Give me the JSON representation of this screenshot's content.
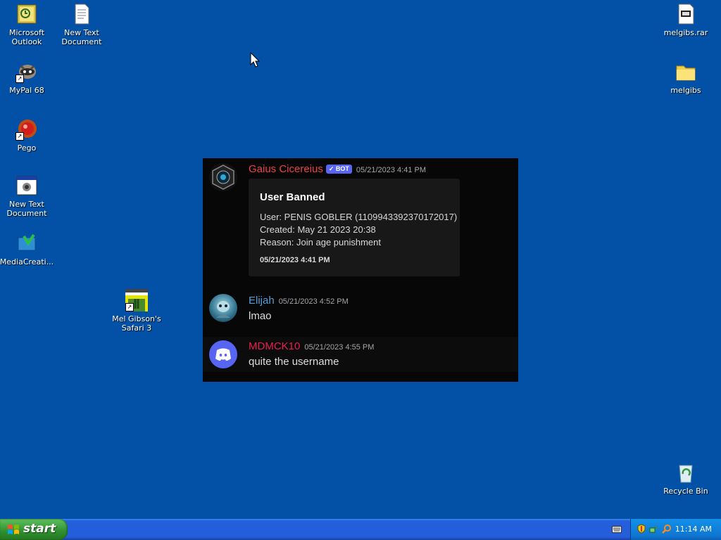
{
  "desktop": {
    "icons": [
      {
        "label": "Microsoft\nOutlook",
        "icon": "outlook-icon"
      },
      {
        "label": "New Text\nDocument",
        "icon": "text-document-icon"
      },
      {
        "label": "MyPal 68",
        "icon": "mypal-browser-icon"
      },
      {
        "label": "Pego",
        "icon": "pego-icon"
      },
      {
        "label": "New Text\nDocument",
        "icon": "program-window-icon"
      },
      {
        "label": "MediaCreati...",
        "icon": "media-creation-tool-icon"
      },
      {
        "label": "Mel Gibson's\nSafari 3",
        "icon": "game-shortcut-icon"
      },
      {
        "label": "melgibs.rar",
        "icon": "rar-archive-icon"
      },
      {
        "label": "melgibs",
        "icon": "folder-icon"
      },
      {
        "label": "Recycle Bin",
        "icon": "recycle-bin-icon"
      }
    ]
  },
  "discord": {
    "messages": [
      {
        "username": "Gaius Cicereius",
        "badge": "✓ BOT",
        "timestamp": "05/21/2023 4:41 PM",
        "name_color": "#ed4245",
        "embed": {
          "title": "User Banned",
          "lines": [
            "User: PENIS GOBLER (1109943392370172017)",
            "Created: May 21 2023 20:38",
            "Reason: Join age punishment"
          ],
          "footer": "05/21/2023 4:41 PM"
        }
      },
      {
        "username": "Elijah",
        "timestamp": "05/21/2023 4:52 PM",
        "name_color": "#5b9bd5",
        "text": "lmao"
      },
      {
        "username": "MDMCK10",
        "timestamp": "05/21/2023 4:55 PM",
        "name_color": "#e91e4d",
        "text": "quite the username"
      }
    ]
  },
  "taskbar": {
    "start_label": "start",
    "clock": "11:14 AM"
  },
  "colors": {
    "desktop_bg": "#0351a6",
    "discord_bg": "#070707",
    "embed_bg": "#181818",
    "bot_badge": "#5865f2"
  }
}
